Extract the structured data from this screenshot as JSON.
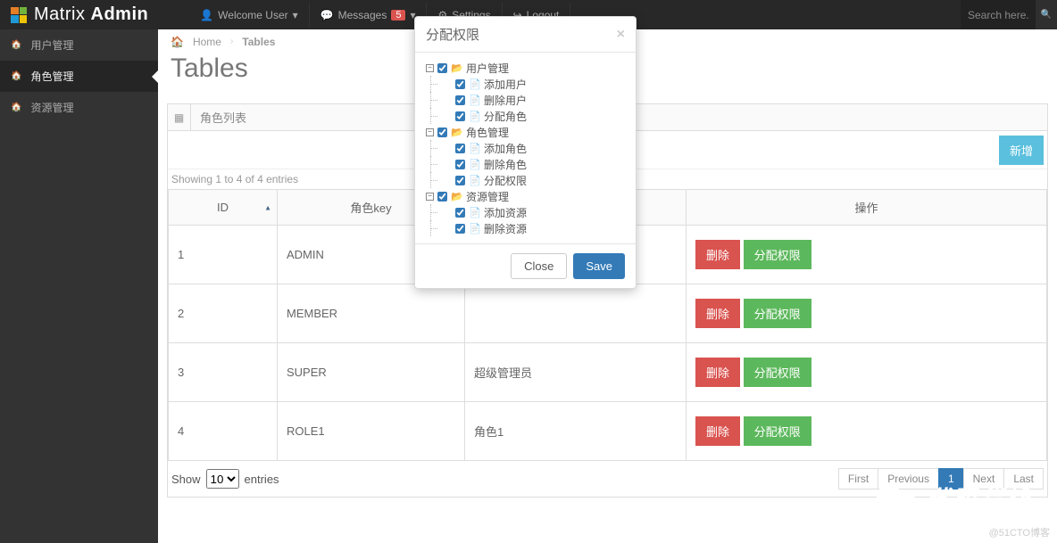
{
  "brand": {
    "a": "Matrix ",
    "b": "Admin"
  },
  "topnav": {
    "welcome": "Welcome User",
    "messages": "Messages",
    "messages_badge": "5",
    "settings": "Settings",
    "logout": "Logout"
  },
  "search": {
    "placeholder": "Search here..."
  },
  "sidebar": {
    "items": [
      {
        "label": "用户管理"
      },
      {
        "label": "角色管理"
      },
      {
        "label": "资源管理"
      }
    ]
  },
  "breadcrumb": {
    "home": "Home",
    "current": "Tables"
  },
  "page": {
    "h1": "Tables",
    "panel_title": "角色列表",
    "new_btn": "新增",
    "showing": "Showing 1 to 4 of 4 entries"
  },
  "table": {
    "cols": {
      "id": "ID",
      "key": "角色key",
      "name_hidden": "",
      "ops": "操作"
    },
    "rows": [
      {
        "id": "1",
        "key": "ADMIN",
        "name": ""
      },
      {
        "id": "2",
        "key": "MEMBER",
        "name": ""
      },
      {
        "id": "3",
        "key": "SUPER",
        "name": "超级管理员"
      },
      {
        "id": "4",
        "key": "ROLE1",
        "name": "角色1"
      }
    ],
    "btn_del": "删除",
    "btn_assign": "分配权限"
  },
  "footer": {
    "show": "Show",
    "entries": "entries",
    "select": "10",
    "first": "First",
    "prev": "Previous",
    "page": "1",
    "next": "Next",
    "last": "Last"
  },
  "modal": {
    "title": "分配权限",
    "close": "Close",
    "save": "Save",
    "tree": [
      {
        "label": "用户管理",
        "children": [
          {
            "label": "添加用户"
          },
          {
            "label": "删除用户"
          },
          {
            "label": "分配角色"
          }
        ]
      },
      {
        "label": "角色管理",
        "children": [
          {
            "label": "添加角色"
          },
          {
            "label": "删除角色"
          },
          {
            "label": "分配权限"
          }
        ]
      },
      {
        "label": "资源管理",
        "children": [
          {
            "label": "添加资源"
          },
          {
            "label": "删除资源"
          }
        ]
      }
    ]
  },
  "watermark": "代码货栈",
  "credit": "@51CTO博客"
}
